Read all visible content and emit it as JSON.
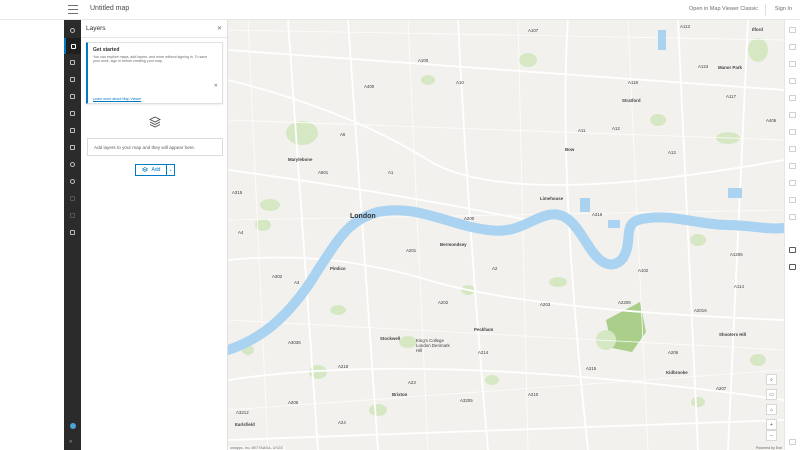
{
  "header": {
    "title": "Untitled map",
    "open_classic": "Open in Map Viewer Classic",
    "sign_in": "Sign In"
  },
  "toolbar": {
    "items": [
      "search-icon",
      "layers-icon",
      "basemap-icon",
      "charts-icon",
      "table-icon",
      "legend-icon",
      "list-icon",
      "bookmark-icon",
      "media-icon",
      "settings-icon",
      "sketch-icon",
      "measure-icon",
      "print-icon"
    ],
    "active": "layers-icon"
  },
  "panel": {
    "title": "Layers",
    "notice": {
      "title": "Get started",
      "body": "You can explore maps, add layers, and more without signing in. To save your work, sign in before creating your map.",
      "link": "Learn more about Map Viewer"
    },
    "empty_text": "Add layers to your map and they will appear here.",
    "add_label": "Add"
  },
  "map": {
    "city_label": "London",
    "areas": [
      "Marylebone",
      "Pimlico",
      "Bermondsey",
      "Limehouse",
      "Bow",
      "Stratford",
      "Ilford",
      "Manor Park",
      "Peckham",
      "Stockwell",
      "Brixton",
      "Earlsfield",
      "Kidbrooke",
      "Shooters Hill",
      "King's College London Denmark Hill"
    ],
    "roads": [
      "A5",
      "A1",
      "A10",
      "A11",
      "A12",
      "A13",
      "A2",
      "A3",
      "A4",
      "A23",
      "A24",
      "A205",
      "A406",
      "A400",
      "A501",
      "A201",
      "A202",
      "A203",
      "A215",
      "A100",
      "A107",
      "A124",
      "A102",
      "A1206",
      "A200",
      "A2208",
      "A214",
      "A3036",
      "A302",
      "A315",
      "A218",
      "A3205",
      "A3212",
      "A316",
      "A117",
      "A118",
      "A113",
      "A114",
      "A2016",
      "A206",
      "A207",
      "A210"
    ],
    "attribution": "onlapps, Inc, METI/NASA, USGS",
    "powered_by": "Powered by Esri",
    "accent": "#007ac2",
    "water": "#a9d3f0",
    "park": "#d5e8c3"
  },
  "controls": [
    "search-icon",
    "screen-icon",
    "bookmark-icon",
    "zoom-in-icon",
    "zoom-out-icon"
  ],
  "right_toolbar": [
    "properties-icon",
    "styles-icon",
    "filter-icon",
    "effects-icon",
    "popups-icon",
    "fields-icon",
    "labels-icon",
    "forms-icon",
    "configure-icon",
    "clustering-icon",
    "sketch-icon",
    "location-icon",
    "directions-icon",
    "measure-icon",
    "expand-icon"
  ]
}
